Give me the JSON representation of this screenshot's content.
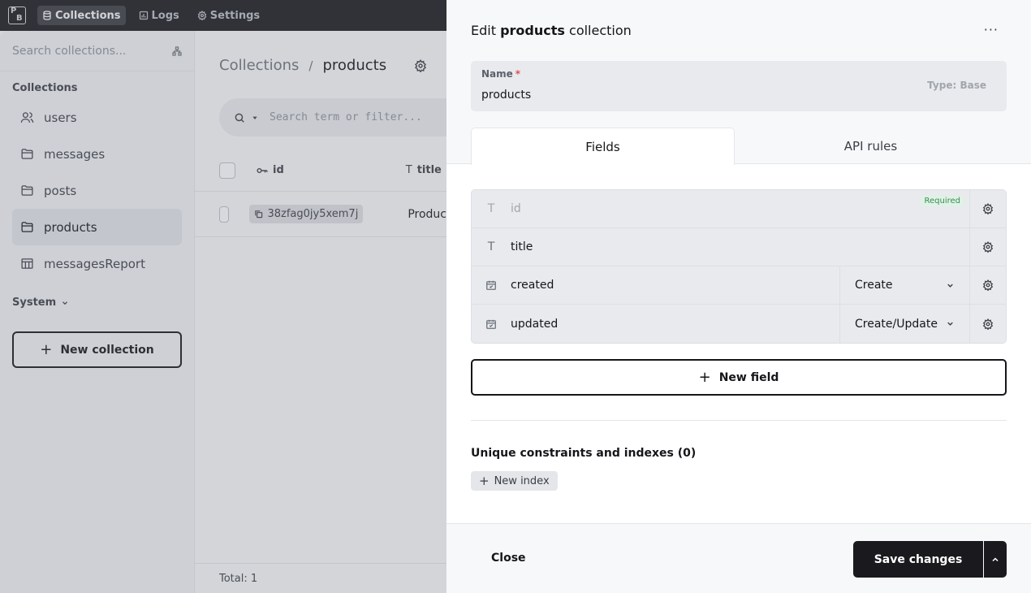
{
  "topbar": {
    "logo_letters": [
      "P",
      "B"
    ],
    "nav": [
      {
        "label": "Collections",
        "icon": "database-icon",
        "active": true
      },
      {
        "label": "Logs",
        "icon": "chart-icon",
        "active": false
      },
      {
        "label": "Settings",
        "icon": "gear-icon",
        "active": false
      }
    ]
  },
  "sidebar": {
    "search_placeholder": "Search collections...",
    "section_title": "Collections",
    "items": [
      {
        "label": "users",
        "icon": "users-icon"
      },
      {
        "label": "messages",
        "icon": "folder-icon"
      },
      {
        "label": "posts",
        "icon": "folder-icon"
      },
      {
        "label": "products",
        "icon": "folder-icon",
        "active": true
      },
      {
        "label": "messagesReport",
        "icon": "table-icon"
      }
    ],
    "system_label": "System",
    "new_collection": "New collection"
  },
  "main": {
    "breadcrumb_root": "Collections",
    "breadcrumb_sep": "/",
    "breadcrumb_current": "products",
    "search_placeholder": "Search term or filter...",
    "columns": [
      {
        "label": "id",
        "icon": "key-icon"
      },
      {
        "label": "title",
        "icon": "text-icon"
      }
    ],
    "rows": [
      {
        "id": "38zfag0jy5xem7j",
        "title": "Produc"
      }
    ],
    "total": "Total: 1"
  },
  "panel": {
    "title_prefix": "Edit",
    "title_name": "products",
    "title_suffix": "collection",
    "more": "···",
    "name_label": "Name",
    "name_required_mark": "*",
    "name_value": "products",
    "type_label": "Type: Base",
    "tabs": [
      "Fields",
      "API rules"
    ],
    "fields": [
      {
        "name": "id",
        "icon": "text-icon",
        "badge": "Required"
      },
      {
        "name": "title",
        "icon": "text-icon"
      },
      {
        "name": "created",
        "icon": "calendar-icon",
        "select": "Create"
      },
      {
        "name": "updated",
        "icon": "calendar-icon",
        "select": "Create/Update"
      }
    ],
    "new_field": "New field",
    "indexes_title": "Unique constraints and indexes (0)",
    "new_index": "New index",
    "close": "Close",
    "save": "Save changes"
  }
}
